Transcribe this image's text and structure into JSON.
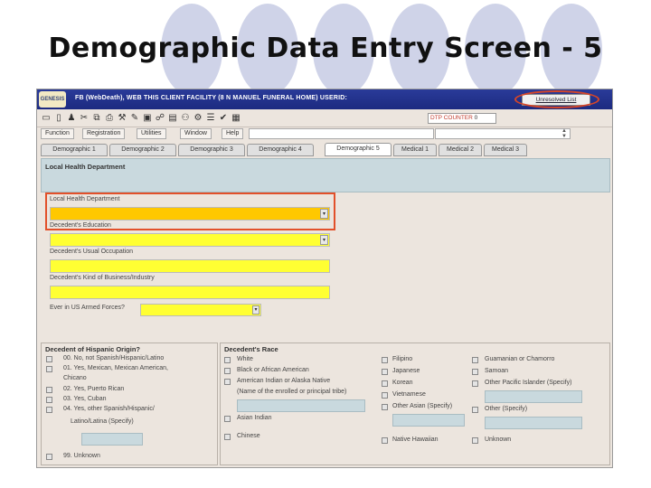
{
  "slide": {
    "title": "Demographic Data Entry Screen - 5"
  },
  "app": {
    "logo_text": "GENESIS",
    "title": "FB (WebDeath), WEB THIS CLIENT FACILITY (8 N MANUEL FUNERAL HOME) USERID:",
    "unresolved_label": "Unresolved List",
    "dtp_label": "DTP COUNTER",
    "dtp_value": "0"
  },
  "menu": [
    "Function",
    "Registration",
    "Utilities",
    "Window",
    "Help"
  ],
  "tabs": [
    "Demographic 1",
    "Demographic 2",
    "Demographic 3",
    "Demographic 4",
    "Demographic 5",
    "Medical 1",
    "Medical 2",
    "Medical 3"
  ],
  "section": {
    "title": "Local Health Department"
  },
  "fields": [
    {
      "label": "Local Health Department"
    },
    {
      "label": "Decedent's Education"
    },
    {
      "label": "Decedent's Usual Occupation"
    },
    {
      "label": "Decedent's Kind of Business/Industry"
    }
  ],
  "armed_forces_label": "Ever in US Armed Forces?",
  "hispanic": {
    "title": "Decedent of Hispanic Origin?",
    "options": [
      "00. No, not Spanish/Hispanic/Latino",
      "01. Yes, Mexican, Mexican American,",
      "Chicano",
      "02. Yes, Puerto Rican",
      "03. Yes, Cuban",
      "04. Yes, other Spanish/Hispanic/",
      "Latino/Latina (Specify)",
      "99. Unknown"
    ]
  },
  "race": {
    "title": "Decedent's Race",
    "col1": [
      "White",
      "Black or African American",
      "American Indian or Alaska Native",
      "(Name of the enrolled or principal tribe)",
      "Asian Indian",
      "Chinese"
    ],
    "col2": [
      "Filipino",
      "Japanese",
      "Korean",
      "Vietnamese",
      "Other Asian (Specify)",
      "Native Hawaiian"
    ],
    "col3": [
      "Guamanian or Chamorro",
      "Samoan",
      "Other Pacific Islander (Specify)",
      "Other (Specify)",
      "Unknown"
    ]
  }
}
